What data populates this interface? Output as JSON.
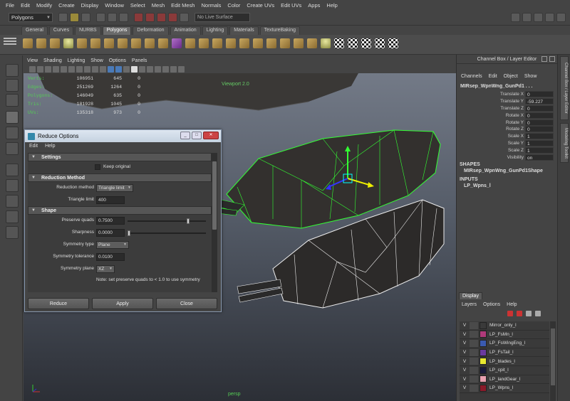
{
  "menubar": [
    "File",
    "Edit",
    "Modify",
    "Create",
    "Display",
    "Window",
    "Select",
    "Mesh",
    "Edit Mesh",
    "Normals",
    "Color",
    "Create UVs",
    "Edit UVs",
    "Apps",
    "Help"
  ],
  "statusline": {
    "mode": "Polygons",
    "live_surface": "No Live Surface"
  },
  "shelf_tabs": [
    "General",
    "Curves",
    "NURBS",
    "Polygons",
    "Deformation",
    "Animation",
    "Lighting",
    "Materials",
    "TextureBaking"
  ],
  "shelf_active_tab": "Polygons",
  "panel_menu": [
    "View",
    "Shading",
    "Lighting",
    "Show",
    "Options",
    "Panels"
  ],
  "hud": [
    {
      "label": "Verts:",
      "v1": "106951",
      "v2": "645",
      "v3": "0"
    },
    {
      "label": "Edges:",
      "v1": "251269",
      "v2": "1264",
      "v3": "0"
    },
    {
      "label": "Polygons:",
      "v1": "146049",
      "v2": "635",
      "v3": "0"
    },
    {
      "label": "Tris:",
      "v1": "181928",
      "v2": "1045",
      "v3": "0"
    },
    {
      "label": "UVs:",
      "v1": "135318",
      "v2": "973",
      "v3": "0"
    }
  ],
  "viewport": {
    "label": "Viewport 2.0",
    "camera": "persp"
  },
  "channel_box": {
    "title": "Channel Box / Layer Editor",
    "menu": [
      "Channels",
      "Edit",
      "Object",
      "Show"
    ],
    "node": "MIRsep_WpnWng_GunPd1 . . .",
    "attributes": [
      {
        "name": "Translate X",
        "value": "0"
      },
      {
        "name": "Translate Y",
        "value": "-59.227"
      },
      {
        "name": "Translate Z",
        "value": "0"
      },
      {
        "name": "Rotate X",
        "value": "0"
      },
      {
        "name": "Rotate Y",
        "value": "0"
      },
      {
        "name": "Rotate Z",
        "value": "0"
      },
      {
        "name": "Scale X",
        "value": "1"
      },
      {
        "name": "Scale Y",
        "value": "1"
      },
      {
        "name": "Scale Z",
        "value": "1"
      },
      {
        "name": "Visibility",
        "value": "on"
      }
    ],
    "shapes_header": "SHAPES",
    "shape_node": "MIRsep_WpnWng_GunPd1Shape",
    "inputs_header": "INPUTS",
    "input_node": "LP_Wpns_l"
  },
  "side_tabs": [
    "Channel Box / Layer Editor",
    "Modeling Toolkit"
  ],
  "layer_editor": {
    "tab": "Display",
    "menu": [
      "Layers",
      "Options",
      "Help"
    ],
    "layers": [
      {
        "v": "V",
        "name": "Mirror_only_l",
        "color": "#3a3a3a"
      },
      {
        "v": "V",
        "name": "LP_FsMn_l",
        "color": "#b03a7a"
      },
      {
        "v": "V",
        "name": "LP_FsWingEng_l",
        "color": "#3a5ab0"
      },
      {
        "v": "V",
        "name": "LP_FsTail_l",
        "color": "#6a3aa0"
      },
      {
        "v": "V",
        "name": "LP_blades_l",
        "color": "#e8e830"
      },
      {
        "v": "V",
        "name": "LP_cpit_l",
        "color": "#1a1a3a"
      },
      {
        "v": "V",
        "name": "LP_landGear_l",
        "color": "#e8a0b0"
      },
      {
        "v": "V",
        "name": "LP_Wpns_l",
        "color": "#8a1a2a"
      }
    ]
  },
  "dialog": {
    "title": "Reduce Options",
    "menu": [
      "Edit",
      "Help"
    ],
    "sections": {
      "settings": "Settings",
      "reduction": "Reduction Method",
      "shape": "Shape"
    },
    "keep_original": "Keep original",
    "reduction_method_label": "Reduction method",
    "reduction_method_value": "Triangle limit",
    "triangle_limit_label": "Triangle limit",
    "triangle_limit_value": "400",
    "preserve_quads_label": "Preserve quads",
    "preserve_quads_value": "0.7500",
    "sharpness_label": "Sharpness",
    "sharpness_value": "0.0000",
    "symmetry_type_label": "Symmetry type",
    "symmetry_type_value": "Plane",
    "symmetry_tolerance_label": "Symmetry tolerance",
    "symmetry_tolerance_value": "0.0100",
    "symmetry_plane_label": "Symmetry plane",
    "symmetry_plane_value": "XZ",
    "note": "Note: set preserve quads to < 1.0 to use symmetry",
    "buttons": {
      "reduce": "Reduce",
      "apply": "Apply",
      "close": "Close"
    }
  }
}
